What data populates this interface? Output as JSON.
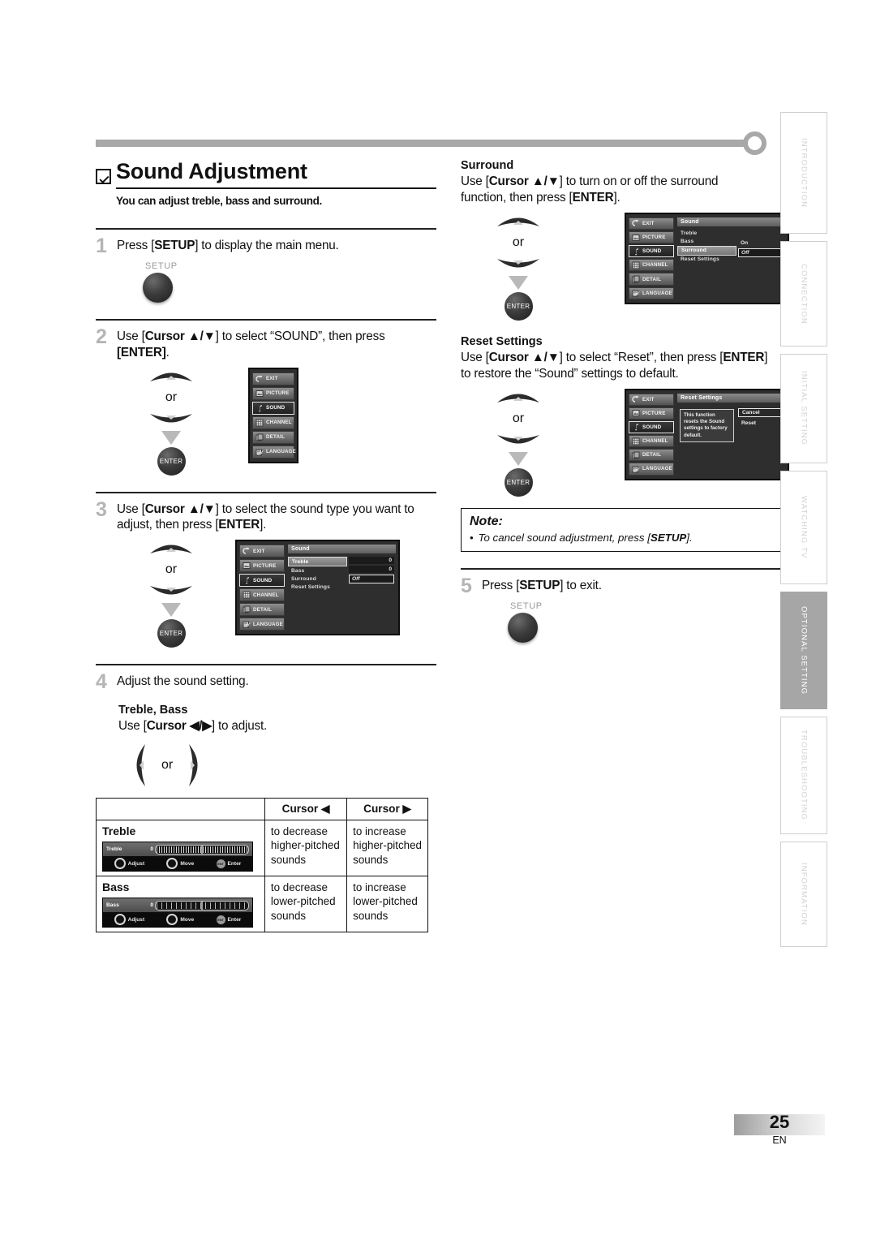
{
  "page": {
    "number": "25",
    "language": "EN"
  },
  "header": {
    "title": "Sound Adjustment",
    "subtitle": "You can adjust treble, bass and surround.",
    "checkbox_icon": "checked-box-icon"
  },
  "steps": [
    {
      "num": "1",
      "text_parts": [
        "Press [",
        "SETUP",
        "] to display the main menu."
      ],
      "text": "Press [SETUP] to display the main menu.",
      "button_label": "SETUP"
    },
    {
      "num": "2",
      "text": "Use [Cursor ▲/▼] to select “SOUND”, then press [ENTER].",
      "enter_label": "ENTER",
      "or_label": "or"
    },
    {
      "num": "3",
      "text": "Use [Cursor ▲/▼] to select the sound type you want to adjust, then press [ENTER].",
      "enter_label": "ENTER",
      "or_label": "or"
    },
    {
      "num": "4",
      "text": "Adjust the sound setting.",
      "section_title": "Treble, Bass",
      "section_text": "Use [Cursor ◀/▶] to adjust.",
      "or_label": "or"
    },
    {
      "num": "5",
      "text": "Press [SETUP] to exit.",
      "button_label": "SETUP"
    }
  ],
  "osd_menu_items": [
    {
      "label": "EXIT",
      "icon": "exit-icon"
    },
    {
      "label": "PICTURE",
      "icon": "picture-icon"
    },
    {
      "label": "SOUND",
      "icon": "sound-note-icon"
    },
    {
      "label": "CHANNEL",
      "icon": "channel-grid-icon"
    },
    {
      "label": "DETAIL",
      "icon": "detail-folder-icon"
    },
    {
      "label": "LANGUAGE",
      "icon": "language-pencil-icon"
    }
  ],
  "osd_sound": {
    "title": "Sound",
    "rows": [
      "Treble",
      "Bass",
      "Surround",
      "Reset Settings"
    ],
    "values": {
      "treble": "0",
      "bass": "0",
      "surround": "Off"
    }
  },
  "osd_surround": {
    "title": "Sound",
    "rows": [
      "Treble",
      "Bass",
      "Surround",
      "Reset Settings"
    ],
    "options": [
      "On",
      "Off"
    ],
    "selected": "Off"
  },
  "osd_reset": {
    "title": "Reset Settings",
    "message": "This function resets the Sound settings to factory default.",
    "buttons": [
      "Cancel",
      "Reset"
    ],
    "selected": "Cancel"
  },
  "cursor_table": {
    "headers": [
      "",
      "Cursor ◀",
      "Cursor ▶"
    ],
    "rows": [
      {
        "name": "Treble",
        "osd": {
          "label": "Treble",
          "value": "0",
          "hints": [
            "Adjust",
            "Move",
            "Enter"
          ]
        },
        "left": "to decrease higher-pitched sounds",
        "right": "to increase higher-pitched sounds"
      },
      {
        "name": "Bass",
        "osd": {
          "label": "Bass",
          "value": "0",
          "hints": [
            "Adjust",
            "Move",
            "Enter"
          ]
        },
        "left": "to decrease lower-pitched sounds",
        "right": "to increase lower-pitched sounds"
      }
    ]
  },
  "right_sections": {
    "surround": {
      "heading": "Surround",
      "text": "Use [Cursor ▲/▼] to turn on or off the surround function, then press [ENTER]."
    },
    "reset": {
      "heading": "Reset Settings",
      "text": "Use [Cursor ▲/▼] to select “Reset”, then press [ENTER] to restore the “Sound” settings to default."
    }
  },
  "note": {
    "title": "Note:",
    "bullet": "•",
    "items": [
      "To cancel sound adjustment, press [SETUP]."
    ]
  },
  "index_tabs": [
    {
      "label": "INTRODUCTION",
      "active": false
    },
    {
      "label": "CONNECTION",
      "active": false
    },
    {
      "label": "INITIAL  SETTING",
      "active": false
    },
    {
      "label": "WATCHING  TV",
      "active": false
    },
    {
      "label": "OPTIONAL  SETTING",
      "active": true
    },
    {
      "label": "TROUBLESHOOTING",
      "active": false
    },
    {
      "label": "INFORMATION",
      "active": false
    }
  ],
  "colors": {
    "accent_gray": "#a8a8a8",
    "active_tab": "#a6a6a6",
    "step_num": "#b5b5b5"
  }
}
